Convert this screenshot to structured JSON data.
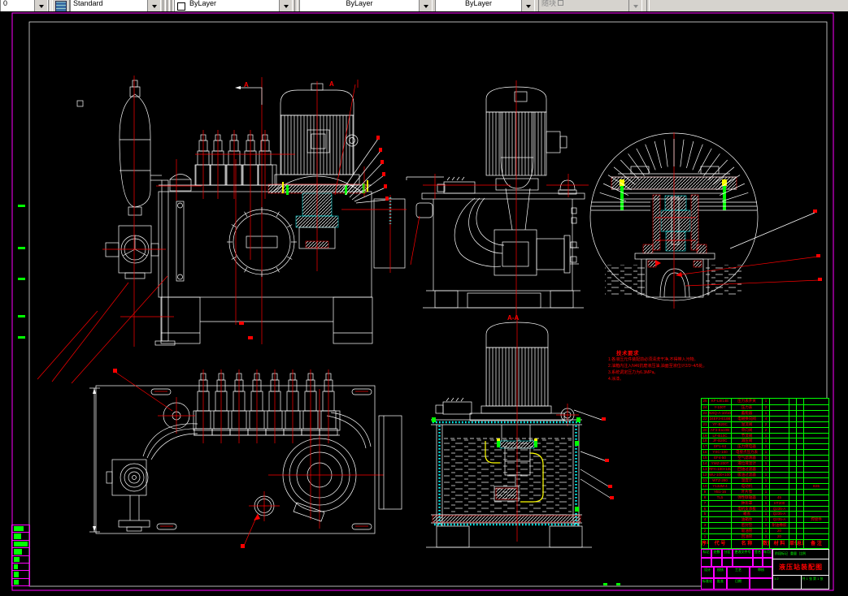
{
  "toolbar": {
    "layer_value": "0",
    "style_label": "Standard",
    "color_value": "ByLayer",
    "linetype_value": "ByLayer",
    "lineweight_value": "ByLayer",
    "plotstyle_value": "随块"
  },
  "drawing": {
    "section_label_left": "A",
    "section_label_right": "A",
    "section_view_label": "A-A"
  },
  "notes": {
    "title": "技术要求",
    "lines": [
      "1.各液压元件装配前必须清洗干净,不得带入污物。",
      "2.油箱内注入N46抗磨液压油,油面至液位计2/3~4/5处。",
      "3.系统调定压力为6.3MPa。",
      "4.涂漆。"
    ]
  },
  "parts_list": {
    "headers": [
      "序号",
      "代  号",
      "名  称",
      "数量",
      "材  料",
      "单件",
      "总计",
      "备  注"
    ],
    "rows": [
      [
        "25",
        "KF-L8/14E",
        "压力表开关",
        "1",
        "",
        "",
        "",
        ""
      ],
      [
        "24",
        "Y-100T",
        "压力表",
        "3",
        "",
        "",
        "",
        ""
      ],
      [
        "23",
        "NXQ-A-10/10-L",
        "蓄能器",
        "1",
        "",
        "",
        "",
        ""
      ],
      [
        "22",
        "34EF3-E10B",
        "电磁换向阀",
        "4",
        "",
        "",
        "",
        ""
      ],
      [
        "21",
        "YF-B20C",
        "溢流阀",
        "2",
        "",
        "",
        "",
        ""
      ],
      [
        "20",
        "AF3-Ea10B",
        "单向阀",
        "2",
        "",
        "",
        "",
        ""
      ],
      [
        "19",
        "LF-B10C",
        "节流阀",
        "1",
        "",
        "",
        "",
        ""
      ],
      [
        "18",
        "JF-B20C",
        "减压阀",
        "1",
        "",
        "",
        "",
        ""
      ],
      [
        "17",
        "DP1-63",
        "压力继电器",
        "1",
        "",
        "",
        "",
        ""
      ],
      [
        "16",
        "YXC-100",
        "电接点压力表",
        "1",
        "",
        "",
        "",
        ""
      ],
      [
        "15",
        "EF4-50",
        "空气滤清器",
        "1",
        "",
        "",
        "",
        ""
      ],
      [
        "14",
        "YWZ-200T",
        "液位液温计",
        "1",
        "",
        "",
        "",
        ""
      ],
      [
        "13",
        "RFA-100×10L-Y",
        "回油过滤器",
        "1",
        "",
        "",
        "",
        ""
      ],
      [
        "12",
        "WU-100×100-J",
        "吸油过滤器",
        "1",
        "",
        "",
        "",
        ""
      ],
      [
        "11",
        "WTZ-280",
        "温度计",
        "1",
        "",
        "",
        "",
        ""
      ],
      [
        "10",
        "Y132M-4",
        "电动机",
        "1",
        "",
        "",
        "",
        "B35"
      ],
      [
        "9",
        "YB1-16",
        "叶片泵",
        "1",
        "",
        "",
        "",
        ""
      ],
      [
        "8",
        "TL5",
        "弹性联轴器",
        "1",
        "45",
        "",
        "",
        ""
      ],
      [
        "7",
        "",
        "钟形罩",
        "1",
        "HT200",
        "",
        "",
        ""
      ],
      [
        "6",
        "",
        "电机支承板",
        "1",
        "Q235-A",
        "",
        "",
        ""
      ],
      [
        "5",
        "",
        "箱盖",
        "1",
        "Q235-A",
        "",
        "",
        ""
      ],
      [
        "4",
        "",
        "油箱体",
        "1",
        "Q235-A",
        "",
        "",
        "焊接件"
      ],
      [
        "3",
        "",
        "密封垫",
        "1",
        "耐油橡胶",
        "",
        "",
        ""
      ],
      [
        "2",
        "",
        "吸油管",
        "1",
        "20",
        "",
        "",
        ""
      ],
      [
        "1",
        "",
        "回油管",
        "1",
        "20",
        "",
        "",
        ""
      ]
    ]
  },
  "title_block": {
    "title": "液压站装配图",
    "left_top": [
      "标记",
      "处数",
      "分区",
      "更改文件号",
      "签名",
      "年月日"
    ],
    "left_bottom": [
      "设计",
      "校核",
      "工艺",
      "审核",
      "标准化",
      "批准",
      "日期",
      ""
    ],
    "stage_label": "阶段标记",
    "weight_label": "重量",
    "scale_label": "比例",
    "scale": "1:2",
    "sheet": "共 1 张 第 1 张"
  },
  "corner_strip": {
    "rows": [
      12,
      9,
      17,
      10,
      7,
      5,
      6,
      6
    ]
  }
}
